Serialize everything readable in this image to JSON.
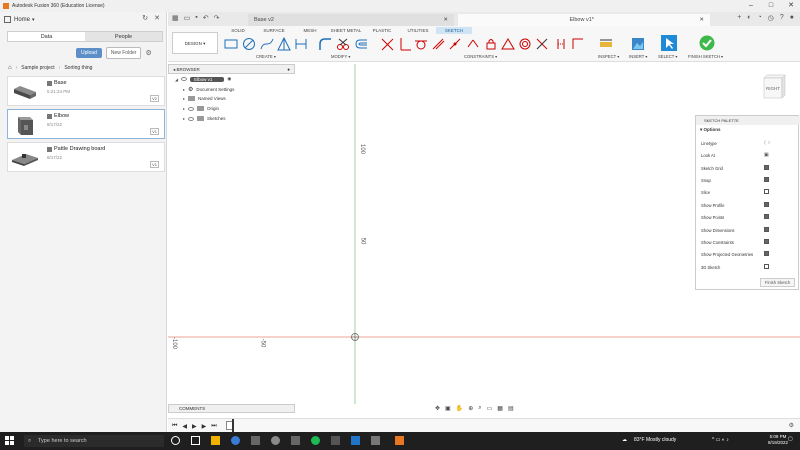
{
  "window": {
    "title": "Autodesk Fusion 360 (Education License)"
  },
  "left_panel": {
    "home_label": "Home",
    "tabs": [
      {
        "label": "Data"
      },
      {
        "label": "People"
      }
    ],
    "upload_label": "Upload",
    "new_folder_label": "New Folder",
    "breadcrumb": [
      "Sample project",
      "Sorting thing"
    ],
    "files": [
      {
        "name": "Base",
        "date": "5:21:24 PM",
        "version": "V2"
      },
      {
        "name": "Elbow",
        "date": "8/17/22",
        "version": "V1"
      },
      {
        "name": "Pattle Drawing board",
        "date": "8/17/22",
        "version": "V1"
      }
    ]
  },
  "doc_tabs": {
    "inactive": "Base v2",
    "active": "Elbow v1*"
  },
  "toolbar": {
    "design_label": "DESIGN",
    "tabs": [
      "SOLID",
      "SURFACE",
      "MESH",
      "SHEET METAL",
      "PLASTIC",
      "UTILITIES",
      "SKETCH"
    ],
    "groups": {
      "create": "CREATE",
      "modify": "MODIFY",
      "constraints": "CONSTRAINTS",
      "inspect": "INSPECT",
      "insert": "INSERT",
      "select": "SELECT",
      "finish": "FINISH SKETCH"
    }
  },
  "browser": {
    "title": "BROWSER",
    "root": "Elbow v1",
    "items": [
      "Document Settings",
      "Named Views",
      "Origin",
      "Sketches"
    ]
  },
  "canvas": {
    "labels": {
      "v100": "100",
      "v50": "50",
      "h100": "-100",
      "h50": "-50"
    },
    "viewcube": "RIGHT"
  },
  "palette": {
    "title": "SKETCH PALETTE",
    "options_label": "Options",
    "rows": [
      {
        "label": "Linetype"
      },
      {
        "label": "Look At"
      },
      {
        "label": "Sketch Grid",
        "checked": true
      },
      {
        "label": "Snap",
        "checked": true
      },
      {
        "label": "Slice",
        "checked": false
      },
      {
        "label": "Show Profile",
        "checked": true
      },
      {
        "label": "Show Points",
        "checked": true
      },
      {
        "label": "Show Dimensions",
        "checked": true
      },
      {
        "label": "Show Constraints",
        "checked": true
      },
      {
        "label": "Show Projected Geometries",
        "checked": true
      },
      {
        "label": "3D Sketch",
        "checked": false
      }
    ],
    "finish_label": "Finish Sketch"
  },
  "comments": {
    "label": "COMMENTS"
  },
  "taskbar": {
    "search_placeholder": "Type here to search",
    "weather": "83°F  Mostly cloudy",
    "time": "5:08 PM",
    "date": "8/19/2022"
  },
  "colors": {
    "accent": "#0696d7",
    "finish_green": "#3cb94a",
    "x_axis": "#e08a7d",
    "y_axis": "#7fbf7f"
  }
}
